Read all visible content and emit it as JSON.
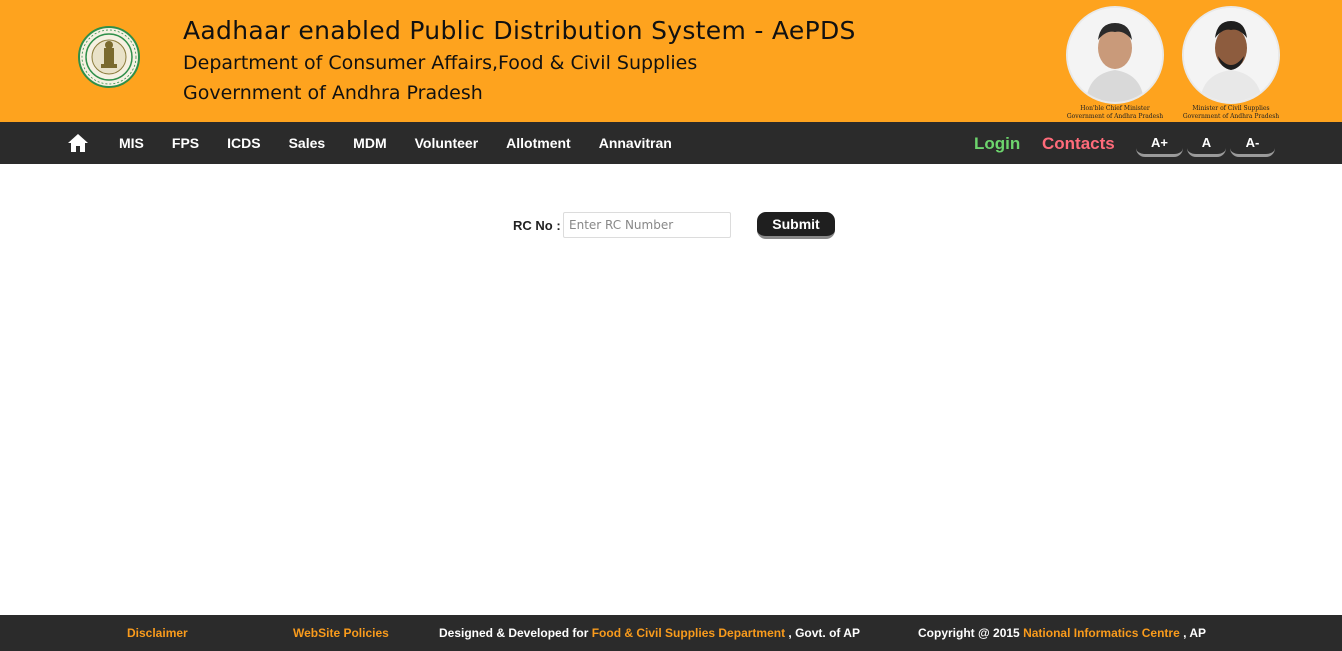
{
  "header": {
    "title": "Aadhaar enabled Public Distribution System - AePDS",
    "department": "Department of Consumer Affairs,Food & Civil Supplies",
    "government": "Government of Andhra Pradesh",
    "emblem_icon": "andhra-pradesh-emblem",
    "leaders": [
      {
        "caption_line1": "Hon'ble Chief Minister",
        "caption_line2": "Government of Andhra Pradesh"
      },
      {
        "caption_line1": "Minister of Civil Supplies",
        "caption_line2": "Government of Andhra Pradesh"
      }
    ],
    "background_color": "#fea31e"
  },
  "nav": {
    "home_icon": "home-icon",
    "items": [
      "MIS",
      "FPS",
      "ICDS",
      "Sales",
      "MDM",
      "Volunteer",
      "Allotment",
      "Annavitran"
    ],
    "login": "Login",
    "contacts": "Contacts",
    "font_buttons": [
      "A+",
      "A",
      "A-"
    ],
    "login_color": "#6dd46d",
    "contacts_color": "#ff6b7a"
  },
  "form": {
    "rc_label": "RC No :",
    "rc_value": "",
    "rc_placeholder": "Enter RC Number",
    "submit_label": "Submit"
  },
  "footer": {
    "disclaimer": "Disclaimer",
    "policies": "WebSite Policies",
    "designed_prefix": "Designed & Developed for",
    "designed_link": "Food & Civil Supplies Department",
    "designed_suffix": ",   Govt. of AP",
    "copyright_prefix": "Copyright @ 2015",
    "copyright_link": "National Informatics Centre",
    "copyright_suffix": ", AP",
    "link_color": "#f99b1c"
  }
}
